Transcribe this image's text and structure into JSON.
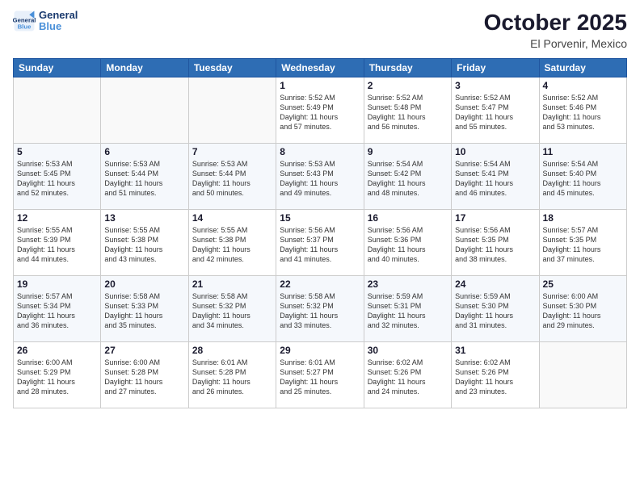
{
  "logo": {
    "line1": "General",
    "line2": "Blue"
  },
  "header": {
    "month": "October 2025",
    "location": "El Porvenir, Mexico"
  },
  "weekdays": [
    "Sunday",
    "Monday",
    "Tuesday",
    "Wednesday",
    "Thursday",
    "Friday",
    "Saturday"
  ],
  "weeks": [
    [
      {
        "day": "",
        "info": ""
      },
      {
        "day": "",
        "info": ""
      },
      {
        "day": "",
        "info": ""
      },
      {
        "day": "1",
        "info": "Sunrise: 5:52 AM\nSunset: 5:49 PM\nDaylight: 11 hours\nand 57 minutes."
      },
      {
        "day": "2",
        "info": "Sunrise: 5:52 AM\nSunset: 5:48 PM\nDaylight: 11 hours\nand 56 minutes."
      },
      {
        "day": "3",
        "info": "Sunrise: 5:52 AM\nSunset: 5:47 PM\nDaylight: 11 hours\nand 55 minutes."
      },
      {
        "day": "4",
        "info": "Sunrise: 5:52 AM\nSunset: 5:46 PM\nDaylight: 11 hours\nand 53 minutes."
      }
    ],
    [
      {
        "day": "5",
        "info": "Sunrise: 5:53 AM\nSunset: 5:45 PM\nDaylight: 11 hours\nand 52 minutes."
      },
      {
        "day": "6",
        "info": "Sunrise: 5:53 AM\nSunset: 5:44 PM\nDaylight: 11 hours\nand 51 minutes."
      },
      {
        "day": "7",
        "info": "Sunrise: 5:53 AM\nSunset: 5:44 PM\nDaylight: 11 hours\nand 50 minutes."
      },
      {
        "day": "8",
        "info": "Sunrise: 5:53 AM\nSunset: 5:43 PM\nDaylight: 11 hours\nand 49 minutes."
      },
      {
        "day": "9",
        "info": "Sunrise: 5:54 AM\nSunset: 5:42 PM\nDaylight: 11 hours\nand 48 minutes."
      },
      {
        "day": "10",
        "info": "Sunrise: 5:54 AM\nSunset: 5:41 PM\nDaylight: 11 hours\nand 46 minutes."
      },
      {
        "day": "11",
        "info": "Sunrise: 5:54 AM\nSunset: 5:40 PM\nDaylight: 11 hours\nand 45 minutes."
      }
    ],
    [
      {
        "day": "12",
        "info": "Sunrise: 5:55 AM\nSunset: 5:39 PM\nDaylight: 11 hours\nand 44 minutes."
      },
      {
        "day": "13",
        "info": "Sunrise: 5:55 AM\nSunset: 5:38 PM\nDaylight: 11 hours\nand 43 minutes."
      },
      {
        "day": "14",
        "info": "Sunrise: 5:55 AM\nSunset: 5:38 PM\nDaylight: 11 hours\nand 42 minutes."
      },
      {
        "day": "15",
        "info": "Sunrise: 5:56 AM\nSunset: 5:37 PM\nDaylight: 11 hours\nand 41 minutes."
      },
      {
        "day": "16",
        "info": "Sunrise: 5:56 AM\nSunset: 5:36 PM\nDaylight: 11 hours\nand 40 minutes."
      },
      {
        "day": "17",
        "info": "Sunrise: 5:56 AM\nSunset: 5:35 PM\nDaylight: 11 hours\nand 38 minutes."
      },
      {
        "day": "18",
        "info": "Sunrise: 5:57 AM\nSunset: 5:35 PM\nDaylight: 11 hours\nand 37 minutes."
      }
    ],
    [
      {
        "day": "19",
        "info": "Sunrise: 5:57 AM\nSunset: 5:34 PM\nDaylight: 11 hours\nand 36 minutes."
      },
      {
        "day": "20",
        "info": "Sunrise: 5:58 AM\nSunset: 5:33 PM\nDaylight: 11 hours\nand 35 minutes."
      },
      {
        "day": "21",
        "info": "Sunrise: 5:58 AM\nSunset: 5:32 PM\nDaylight: 11 hours\nand 34 minutes."
      },
      {
        "day": "22",
        "info": "Sunrise: 5:58 AM\nSunset: 5:32 PM\nDaylight: 11 hours\nand 33 minutes."
      },
      {
        "day": "23",
        "info": "Sunrise: 5:59 AM\nSunset: 5:31 PM\nDaylight: 11 hours\nand 32 minutes."
      },
      {
        "day": "24",
        "info": "Sunrise: 5:59 AM\nSunset: 5:30 PM\nDaylight: 11 hours\nand 31 minutes."
      },
      {
        "day": "25",
        "info": "Sunrise: 6:00 AM\nSunset: 5:30 PM\nDaylight: 11 hours\nand 29 minutes."
      }
    ],
    [
      {
        "day": "26",
        "info": "Sunrise: 6:00 AM\nSunset: 5:29 PM\nDaylight: 11 hours\nand 28 minutes."
      },
      {
        "day": "27",
        "info": "Sunrise: 6:00 AM\nSunset: 5:28 PM\nDaylight: 11 hours\nand 27 minutes."
      },
      {
        "day": "28",
        "info": "Sunrise: 6:01 AM\nSunset: 5:28 PM\nDaylight: 11 hours\nand 26 minutes."
      },
      {
        "day": "29",
        "info": "Sunrise: 6:01 AM\nSunset: 5:27 PM\nDaylight: 11 hours\nand 25 minutes."
      },
      {
        "day": "30",
        "info": "Sunrise: 6:02 AM\nSunset: 5:26 PM\nDaylight: 11 hours\nand 24 minutes."
      },
      {
        "day": "31",
        "info": "Sunrise: 6:02 AM\nSunset: 5:26 PM\nDaylight: 11 hours\nand 23 minutes."
      },
      {
        "day": "",
        "info": ""
      }
    ]
  ]
}
